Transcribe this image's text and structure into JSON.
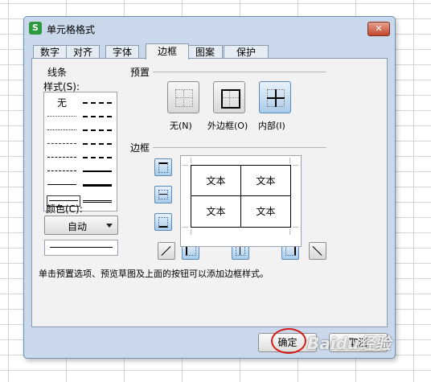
{
  "window": {
    "title": "单元格格式",
    "app_icon_letter": "S",
    "close_label": "✕"
  },
  "tabs": [
    {
      "label": "数字"
    },
    {
      "label": "对齐"
    },
    {
      "label": "字体"
    },
    {
      "label": "边框",
      "active": true
    },
    {
      "label": "图案"
    },
    {
      "label": "保护"
    }
  ],
  "line_section": {
    "group_label": "线条",
    "style_label": "样式(S):",
    "none_label": "无",
    "color_label": "颜色(C):",
    "color_value": "自动"
  },
  "presets": {
    "group_label": "预置",
    "items": [
      {
        "label": "无(N)",
        "icon": "border-none-icon"
      },
      {
        "label": "外边框(O)",
        "icon": "border-outline-icon"
      },
      {
        "label": "内部(I)",
        "icon": "border-inside-icon"
      }
    ]
  },
  "border": {
    "group_label": "边框",
    "preview_cells": [
      "文本",
      "文本",
      "文本",
      "文本"
    ]
  },
  "hint": "单击预置选项、预览草图及上面的按钮可以添加边框样式。",
  "buttons": {
    "ok": "确定",
    "cancel": "取消"
  },
  "watermark": "Baidu经验",
  "colors": {
    "dialog_bg": "#c9d8ea",
    "panel_bg": "#f2f2f2",
    "button_blue": "#a9cbe8",
    "highlight_circle": "#d61a1a"
  }
}
